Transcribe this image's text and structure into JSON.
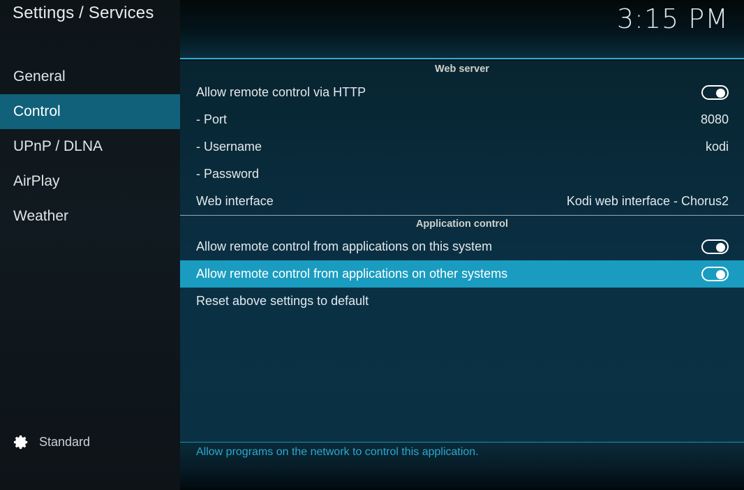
{
  "window": {
    "title": "Settings / Services",
    "clock": "3:15 PM"
  },
  "colors": {
    "sidebar_bg": "#111a20",
    "sidebar_selected": "#106179",
    "row_focused": "#1a9cc0",
    "accent_line": "#2ab0d6",
    "hint_text": "#2ba7cf",
    "section_header_text": "#cfd2cb",
    "main_bg": "#0a3044"
  },
  "sidebar": {
    "items": [
      {
        "label": "General",
        "selected": false,
        "name": "sidebar-item-general"
      },
      {
        "label": "Control",
        "selected": true,
        "name": "sidebar-item-control"
      },
      {
        "label": "UPnP / DLNA",
        "selected": false,
        "name": "sidebar-item-upnp-dlna"
      },
      {
        "label": "AirPlay",
        "selected": false,
        "name": "sidebar-item-airplay"
      },
      {
        "label": "Weather",
        "selected": false,
        "name": "sidebar-item-weather"
      }
    ],
    "profile": {
      "icon": "gear-icon",
      "label": "Standard"
    }
  },
  "sections": [
    {
      "header": "Web server",
      "rows": [
        {
          "label": "Allow remote control via HTTP",
          "control": "toggle",
          "toggle_on": true,
          "value": "",
          "focused": false
        },
        {
          "label": "- Port",
          "control": "value",
          "toggle_on": null,
          "value": "8080",
          "focused": false
        },
        {
          "label": "- Username",
          "control": "value",
          "toggle_on": null,
          "value": "kodi",
          "focused": false
        },
        {
          "label": "- Password",
          "control": "value",
          "toggle_on": null,
          "value": "",
          "focused": false
        },
        {
          "label": "Web interface",
          "control": "value",
          "toggle_on": null,
          "value": "Kodi web interface - Chorus2",
          "focused": false
        }
      ]
    },
    {
      "header": "Application control",
      "rows": [
        {
          "label": "Allow remote control from applications on this system",
          "control": "toggle",
          "toggle_on": true,
          "value": "",
          "focused": false
        },
        {
          "label": "Allow remote control from applications on other systems",
          "control": "toggle",
          "toggle_on": true,
          "value": "",
          "focused": true
        },
        {
          "label": "Reset above settings to default",
          "control": "none",
          "toggle_on": null,
          "value": "",
          "focused": false
        }
      ]
    }
  ],
  "hint": {
    "text": "Allow programs on the network to control this application."
  }
}
